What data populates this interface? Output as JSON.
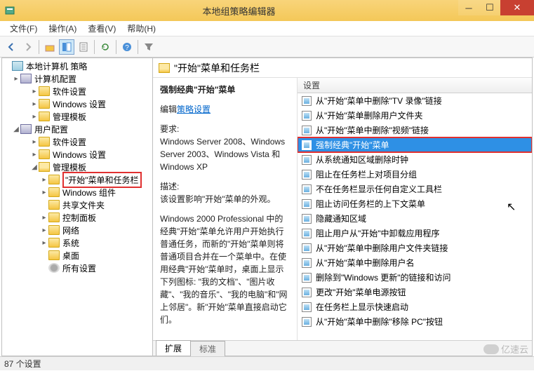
{
  "window": {
    "title": "本地组策略编辑器"
  },
  "menu": {
    "file": "文件(F)",
    "action": "操作(A)",
    "view": "查看(V)",
    "help": "帮助(H)"
  },
  "tree": {
    "root": "本地计算机 策略",
    "computer_config": "计算机配置",
    "software_settings1": "软件设置",
    "windows_settings1": "Windows 设置",
    "admin_templates1": "管理模板",
    "user_config": "用户配置",
    "software_settings2": "软件设置",
    "windows_settings2": "Windows 设置",
    "admin_templates2": "管理模板",
    "start_taskbar": "\"开始\"菜单和任务栏",
    "windows_components": "Windows 组件",
    "shared_folders": "共享文件夹",
    "control_panel": "控制面板",
    "network": "网络",
    "system": "系统",
    "desktop": "桌面",
    "all_settings": "所有设置"
  },
  "right": {
    "heading": "\"开始\"菜单和任务栏",
    "setting_title": "强制经典\"开始\"菜单",
    "edit_link_pre": "编辑",
    "edit_link": "策略设置",
    "req_label": "要求:",
    "req_body": "Windows Server 2008、Windows Server 2003、Windows Vista 和 Windows XP",
    "desc_label": "描述:",
    "desc_line1": "该设置影响\"开始\"菜单的外观。",
    "desc_body": "Windows 2000 Professional 中的经典\"开始\"菜单允许用户开始执行普通任务，而新的\"开始\"菜单则将普通项目合并在一个菜单中。在使用经典\"开始\"菜单时，桌面上显示下列图标: \"我的文档\"、\"图片收藏\"、\"我的音乐\"、\"我的电脑\"和\"网上邻居\"。新\"开始\"菜单直接启动它们。",
    "col_header": "设置",
    "items": [
      "从\"开始\"菜单中删除\"TV 录像\"链接",
      "从\"开始\"菜单删除用户文件夹",
      "从\"开始\"菜单中删除\"视频\"链接",
      "强制经典\"开始\"菜单",
      "从系统通知区域删除时钟",
      "阻止在任务栏上对项目分组",
      "不在任务栏显示任何自定义工具栏",
      "阻止访问任务栏的上下文菜单",
      "隐藏通知区域",
      "阻止用户从\"开始\"中卸载应用程序",
      "从\"开始\"菜单中删除用户文件夹链接",
      "从\"开始\"菜单中删除用户名",
      "删除到\"Windows 更新\"的链接和访问",
      "更改\"开始\"菜单电源按钮",
      "在任务栏上显示快速启动",
      "从\"开始\"菜单中删除\"移除 PC\"按钮"
    ],
    "selected_index": 3
  },
  "footer_tabs": {
    "extended": "扩展",
    "standard": "标准"
  },
  "statusbar": {
    "text": "87 个设置"
  },
  "watermark": "亿速云"
}
